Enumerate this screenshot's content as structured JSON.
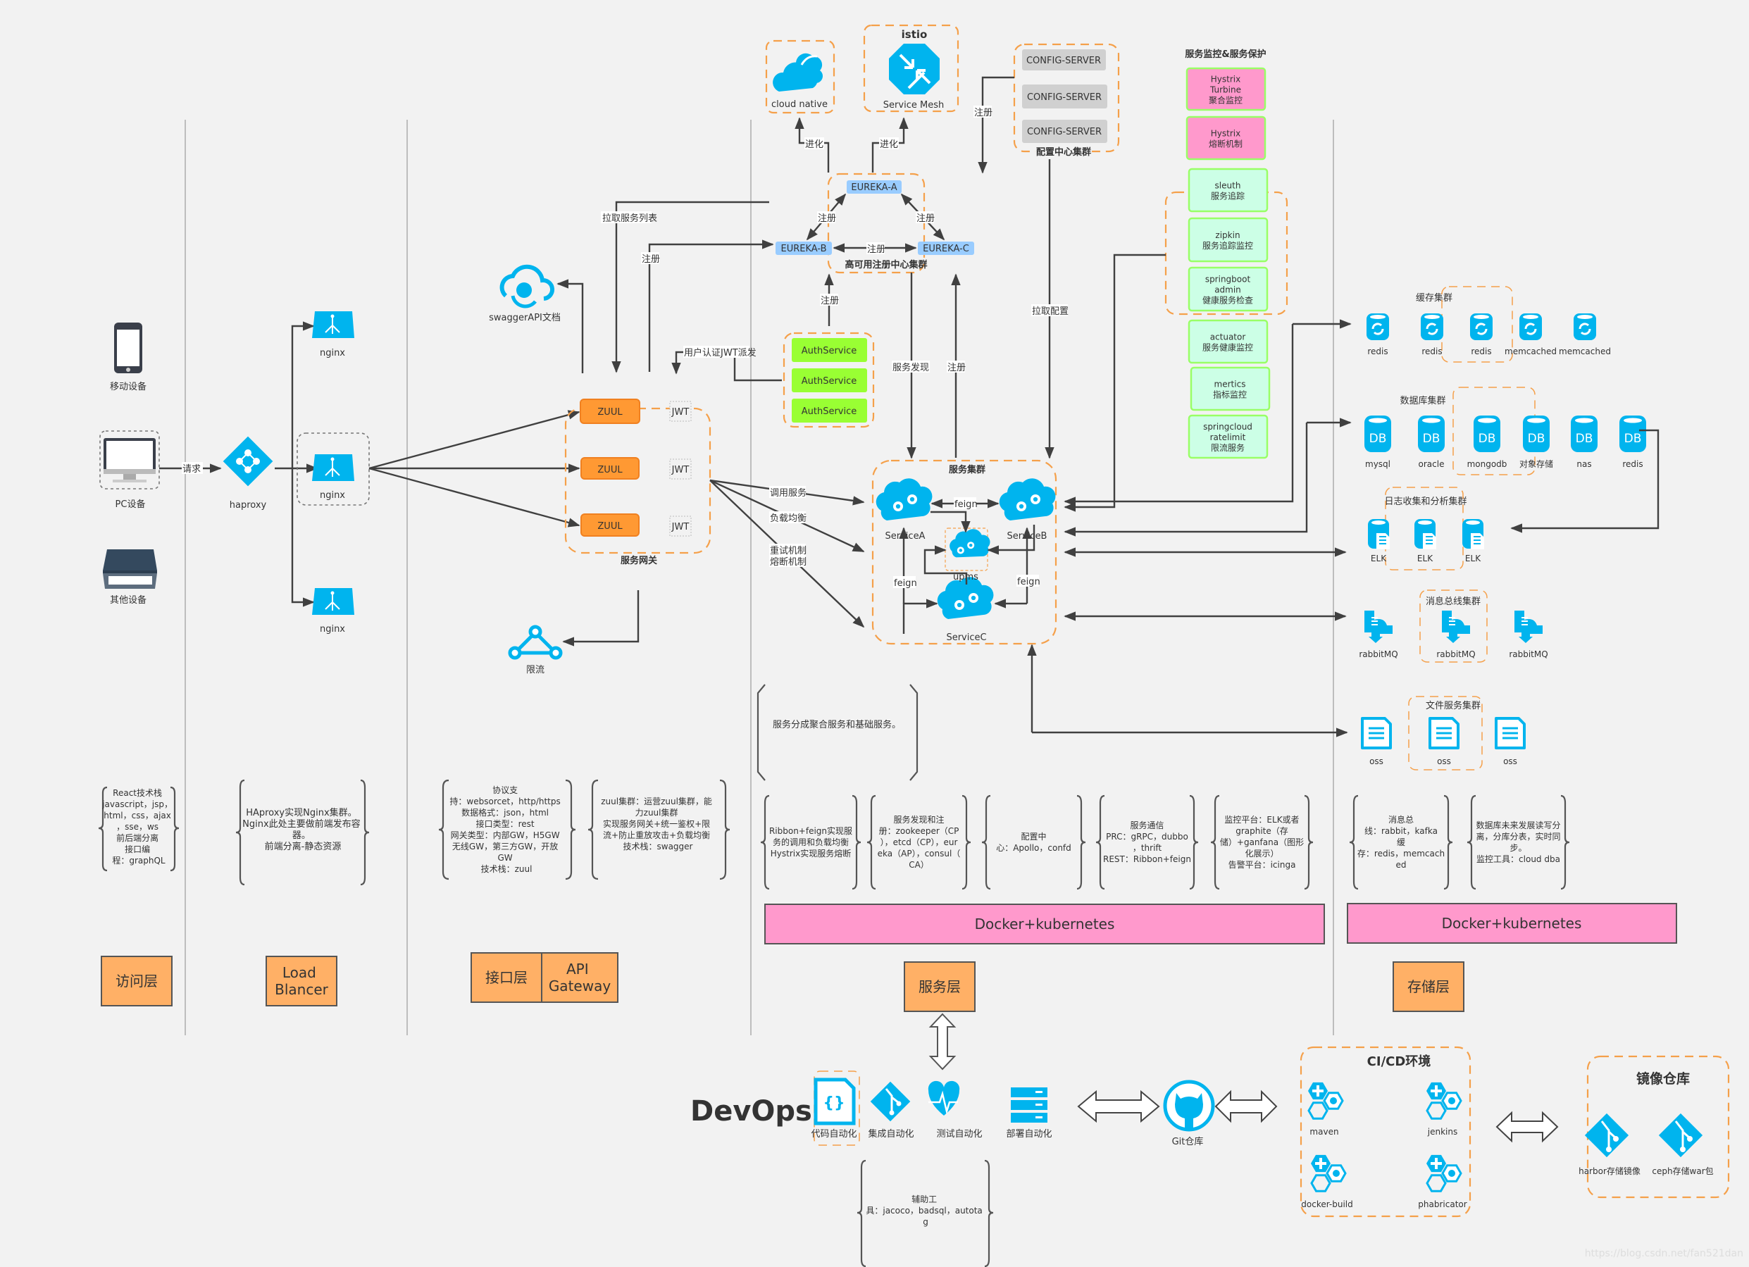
{
  "access_layer": {
    "devices": [
      {
        "label": "移动设备",
        "icon": "smartphone-icon"
      },
      {
        "label": "PC设备",
        "icon": "desktop-monitor-icon"
      },
      {
        "label": "其他设备",
        "icon": "scanner-icon"
      }
    ],
    "request_label": "请求",
    "note_lines": [
      "React技术栈",
      "javascript，jsp，",
      "html，css，ajax",
      "，sse，ws",
      "前后端分离",
      "接口编",
      "程：graphQL"
    ],
    "layer_label": "访问层"
  },
  "load_balancer": {
    "haproxy_label": "haproxy",
    "nginx_labels": [
      "nginx",
      "nginx",
      "nginx"
    ],
    "note_lines": [
      "HAproxy实现Nginx集群。",
      "Nginx此处主要做前端发布容",
      "器。",
      "前端分离-静态资源"
    ],
    "layer_label_lines": [
      "Load",
      "Blancer"
    ]
  },
  "gateway": {
    "zuul_labels": [
      "ZUUL",
      "ZUUL",
      "ZUUL"
    ],
    "jwt_labels": [
      "JWT",
      "JWT",
      "JWT"
    ],
    "group_label": "服务网关",
    "swagger_label": "swaggerAPI文档",
    "ratelimit_label": "限流",
    "note1_lines": [
      "协议支",
      "持：websorcet，http/https",
      "数据格式：json，html",
      "接口类型：rest",
      "网关类型：内部GW，H5GW",
      "无线GW，第三方GW，开放",
      "GW",
      "技术栈：zuul"
    ],
    "note2_lines": [
      "zuul集群：运营zuul集群，能",
      "力zuul集群",
      "实现服务网关+统一鉴权+限",
      "流+防止重放攻击+负载均衡",
      "技术栈：swagger"
    ],
    "layer_label": "接口层",
    "layer_label2_lines": [
      "API",
      "Gateway"
    ]
  },
  "edges": {
    "pull_service_list": "拉取服务列表",
    "register": "注册",
    "user_auth_jwt": "用户认证JWT派发",
    "invoke_service": "调用服务",
    "load_balance": "负载均衡",
    "retry_lines": [
      "重试机制",
      "熔断机制"
    ],
    "evolve": "进化",
    "service_discovery": "服务发现",
    "pull_config": "拉取配置"
  },
  "evolution": {
    "cloud_native_label": "cloud native",
    "istio_title": "istio",
    "service_mesh_label": "Service Mesh"
  },
  "eureka": {
    "nodes": [
      "EUREKA-A",
      "EUREKA-B",
      "EUREKA-C"
    ],
    "group_label": "高可用注册中心集群"
  },
  "config_center": {
    "servers": [
      "CONFIG-SERVER",
      "CONFIG-SERVER",
      "CONFIG-SERVER"
    ],
    "group_label": "配置中心集群"
  },
  "auth": {
    "services": [
      "AuthService",
      "AuthService",
      "AuthService"
    ]
  },
  "monitoring": {
    "title": "服务监控&服务保护",
    "items": [
      {
        "lines": [
          "Hystrix",
          "Turbine",
          "聚合监控"
        ],
        "style": "pink"
      },
      {
        "lines": [
          "Hystrix",
          "熔断机制"
        ],
        "style": "pink"
      },
      {
        "lines": [
          "sleuth",
          "服务追踪"
        ],
        "style": "mint"
      },
      {
        "lines": [
          "zipkin",
          "服务追踪监控"
        ],
        "style": "mint"
      },
      {
        "lines": [
          "springboot",
          "admin",
          "健康服务检查"
        ],
        "style": "mint"
      },
      {
        "lines": [
          "actuator",
          "服务健康监控"
        ],
        "style": "mint"
      },
      {
        "lines": [
          "mertics",
          "指标监控"
        ],
        "style": "mint"
      },
      {
        "lines": [
          "springcloud",
          "ratelimit",
          "限流服务"
        ],
        "style": "mint"
      }
    ]
  },
  "service_cluster": {
    "title": "服务集群",
    "services": [
      "ServiceA",
      "ServiceB",
      "upms",
      "ServiceC"
    ],
    "feign_label": "feign",
    "note": "服务分成聚合服务和基础服务。",
    "notes": [
      [
        "Ribbon+feign实现服",
        "务的调用和负载均衡",
        "Hystrix实现服务熔断"
      ],
      [
        "服务发现和注",
        "册：zookeeper（CP",
        "），etcd（CP），eur",
        "eka（AP），consul（",
        "CA）"
      ],
      [
        "配置中",
        "心：Apollo，confd"
      ],
      [
        "服务通信",
        "PRC：gRPC，dubbo",
        "，thrift",
        "REST：Ribbon+feign"
      ],
      [
        "监控平台：ELK或者",
        "graphite（存",
        "储）+ganfana（图形",
        "化展示）",
        "告警平台：icinga"
      ]
    ],
    "platform_label": "Docker+kubernetes",
    "layer_label": "服务层"
  },
  "storage": {
    "cache": {
      "title": "缓存集群",
      "items": [
        "redis",
        "redis",
        "redis",
        "memcached",
        "memcached"
      ]
    },
    "database": {
      "title": "数据库集群",
      "items": [
        "mysql",
        "oracle",
        "mongodb",
        "对象存储",
        "nas",
        "redis"
      ],
      "badge": "DB"
    },
    "log": {
      "title": "日志收集和分析集群",
      "items": [
        "ELK",
        "ELK",
        "ELK"
      ]
    },
    "mq": {
      "title": "消息总线集群",
      "items": [
        "rabbitMQ",
        "rabbitMQ",
        "rabbitMQ"
      ]
    },
    "file": {
      "title": "文件服务集群",
      "items": [
        "oss",
        "oss",
        "oss"
      ]
    },
    "notes": [
      [
        "消息总",
        "线：rabbit，kafka",
        "缓",
        "存：redis，memcach",
        "ed"
      ],
      [
        "数据库未来发展读写分",
        "离，分库分表，实时同",
        "步。",
        "监控工具：cloud dba"
      ]
    ],
    "platform_label": "Docker+kubernetes",
    "layer_label": "存储层"
  },
  "devops": {
    "title": "DevOps",
    "stages": [
      "代码自动化",
      "集成自动化",
      "测试自动化",
      "部署自动化"
    ],
    "aux_note_lines": [
      "辅助工",
      "具：jacoco，badsql，autota",
      "g"
    ],
    "git_label": "Git仓库",
    "cicd_title": "CI/CD环境",
    "cicd_tools": [
      "maven",
      "jenkins",
      "docker-build",
      "phabricator"
    ],
    "registry_title": "镜像仓库",
    "registry_items": [
      "harbor存储镜像",
      "ceph存储war包"
    ]
  },
  "colors": {
    "icon_blue": "#00b4ee",
    "zuul_orange": "#ff9933",
    "layer_orange": "#ffb066",
    "auth_green": "#99ff33",
    "eureka_blue": "#99ccff",
    "config_gray": "#d0d0d0",
    "monitor_pink": "#ff99cc",
    "monitor_mint": "#ccffe6",
    "docker_pink": "#ff99cc",
    "dash_orange": "#f5a04a"
  },
  "watermark": "https://blog.csdn.net/fan521dan"
}
